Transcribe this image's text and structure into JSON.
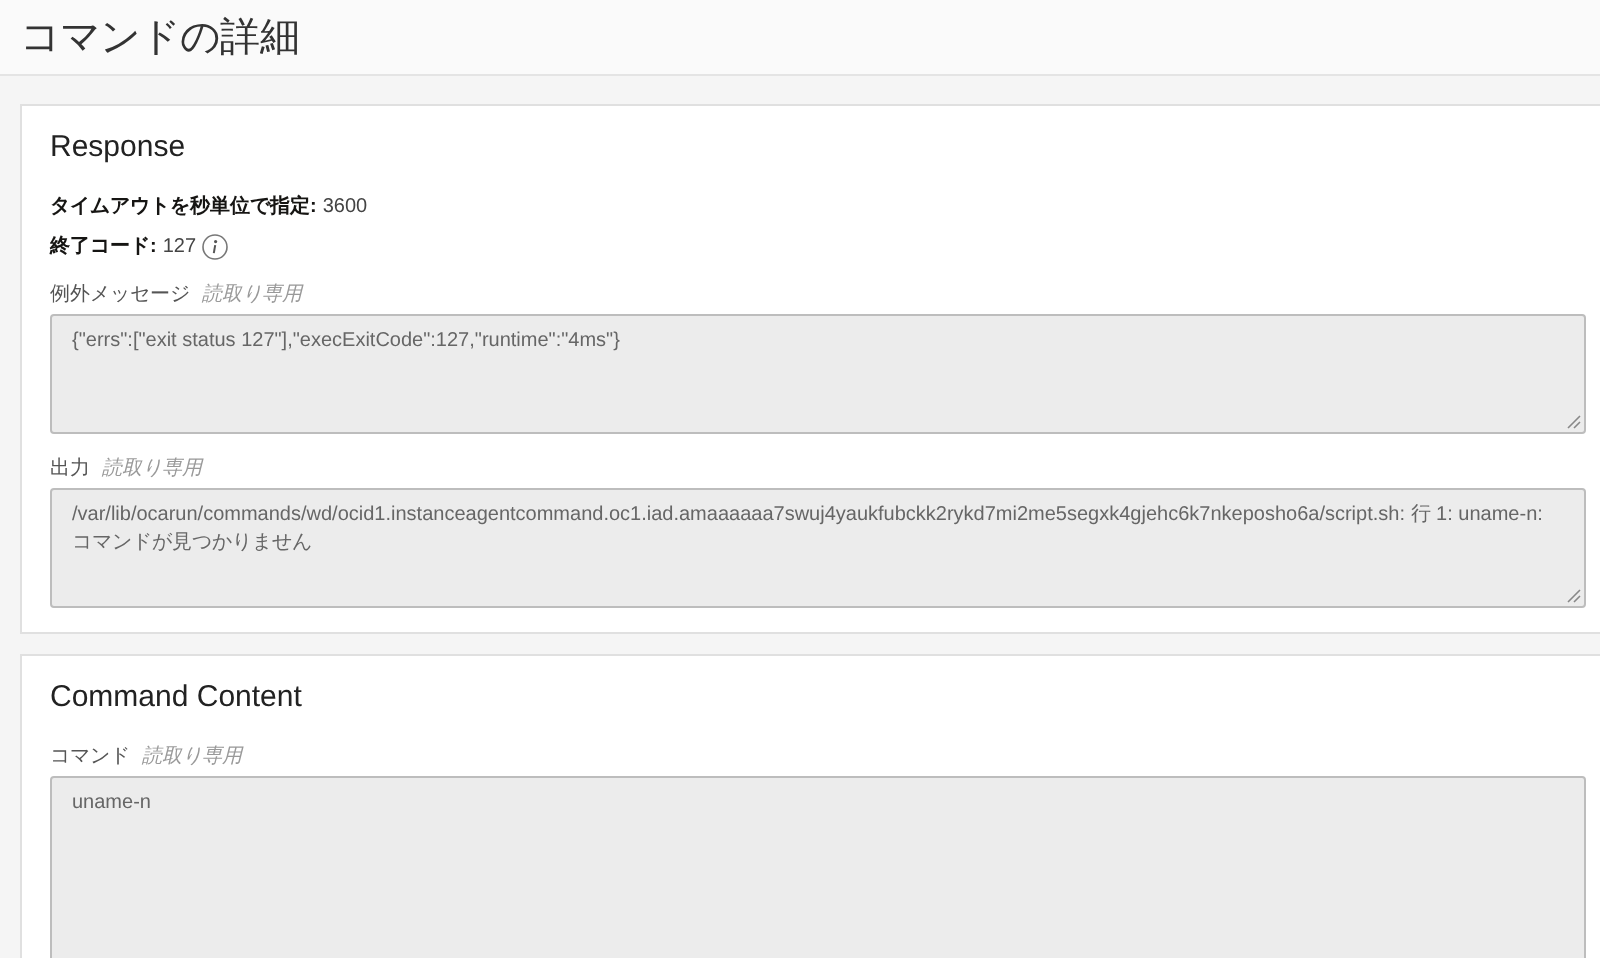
{
  "header": {
    "title": "コマンドの詳細"
  },
  "sections": [
    {
      "title": "Response",
      "properties": [
        {
          "label": "タイムアウトを秒単位で指定:",
          "value": "3600"
        },
        {
          "label": "終了コード:",
          "value": "127",
          "info": true
        }
      ],
      "fields": [
        {
          "label": "例外メッセージ",
          "note": "読取り専用",
          "value": "{\"errs\":[\"exit status 127\"],\"execExitCode\":127,\"runtime\":\"4ms\"}"
        },
        {
          "label": "出力",
          "note": "読取り専用",
          "value": "/var/lib/ocarun/commands/wd/ocid1.instanceagentcommand.oc1.iad.amaaaaaa7swuj4yaukfubckk2rykd7mi2me5segxk4gjehc6k7nkeposho6a/script.sh: 行 1: uname-n: コマンドが見つかりません"
        }
      ]
    },
    {
      "title": "Command Content",
      "fields": [
        {
          "label": "コマンド",
          "note": "読取り専用",
          "value": "uname-n"
        }
      ]
    }
  ]
}
